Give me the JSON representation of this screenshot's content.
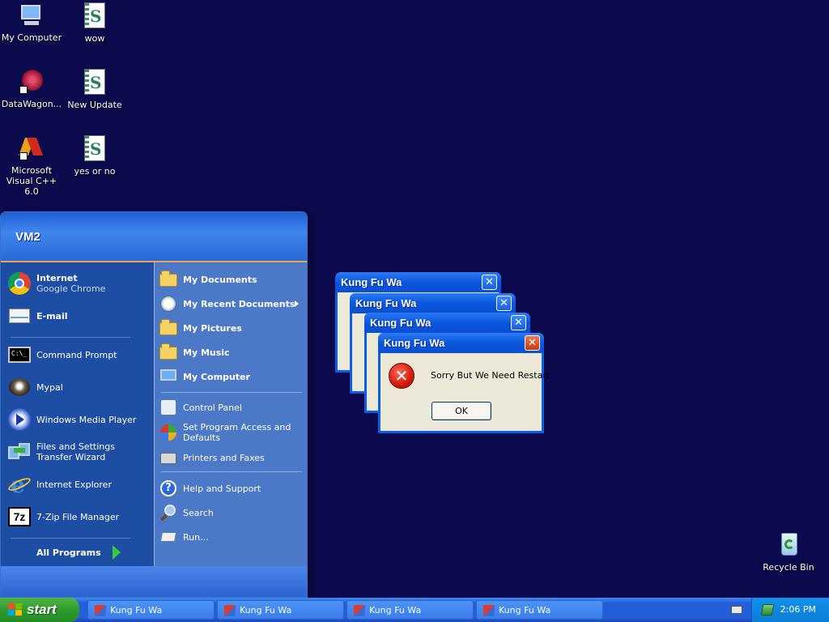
{
  "desktop": {
    "icons": [
      {
        "label": "My Computer"
      },
      {
        "label": "wow"
      },
      {
        "label": "DataWagon..."
      },
      {
        "label": "New Update"
      },
      {
        "label": "Microsoft Visual C++ 6.0"
      },
      {
        "label": "yes or no"
      },
      {
        "label": "Recycle Bin"
      }
    ]
  },
  "start_menu": {
    "user": "VM2",
    "pinned": [
      {
        "title": "Internet",
        "subtitle": "Google Chrome"
      },
      {
        "title": "E-mail"
      }
    ],
    "recent": [
      {
        "label": "Command Prompt"
      },
      {
        "label": "Mypal"
      },
      {
        "label": "Windows Media Player"
      },
      {
        "label": "Files and Settings Transfer Wizard"
      },
      {
        "label": "Internet Explorer"
      },
      {
        "label": "7-Zip File Manager"
      }
    ],
    "all_programs": "All Programs",
    "right": [
      {
        "label": "My Documents"
      },
      {
        "label": "My Recent Documents"
      },
      {
        "label": "My Pictures"
      },
      {
        "label": "My Music"
      },
      {
        "label": "My Computer"
      },
      {
        "label": "Control Panel"
      },
      {
        "label": "Set Program Access and Defaults"
      },
      {
        "label": "Printers and Faxes"
      },
      {
        "label": "Help and Support"
      },
      {
        "label": "Search"
      },
      {
        "label": "Run..."
      }
    ]
  },
  "dialogs": {
    "title": "Kung Fu Wa",
    "message": "Sorry But We Need Restart",
    "ok": "OK",
    "close": "✕"
  },
  "taskbar": {
    "start": "start",
    "tasks": [
      {
        "label": "Kung Fu Wa"
      },
      {
        "label": "Kung Fu Wa"
      },
      {
        "label": "Kung Fu Wa"
      },
      {
        "label": "Kung Fu Wa"
      }
    ],
    "clock": "2:06 PM"
  },
  "colors": {
    "desktop": "#0a0a4c",
    "start_green": "#2f9b2d",
    "taskbar_blue": "#245edb",
    "titlebar_blue": "#0a56dd",
    "error_red": "#d11a0a"
  }
}
